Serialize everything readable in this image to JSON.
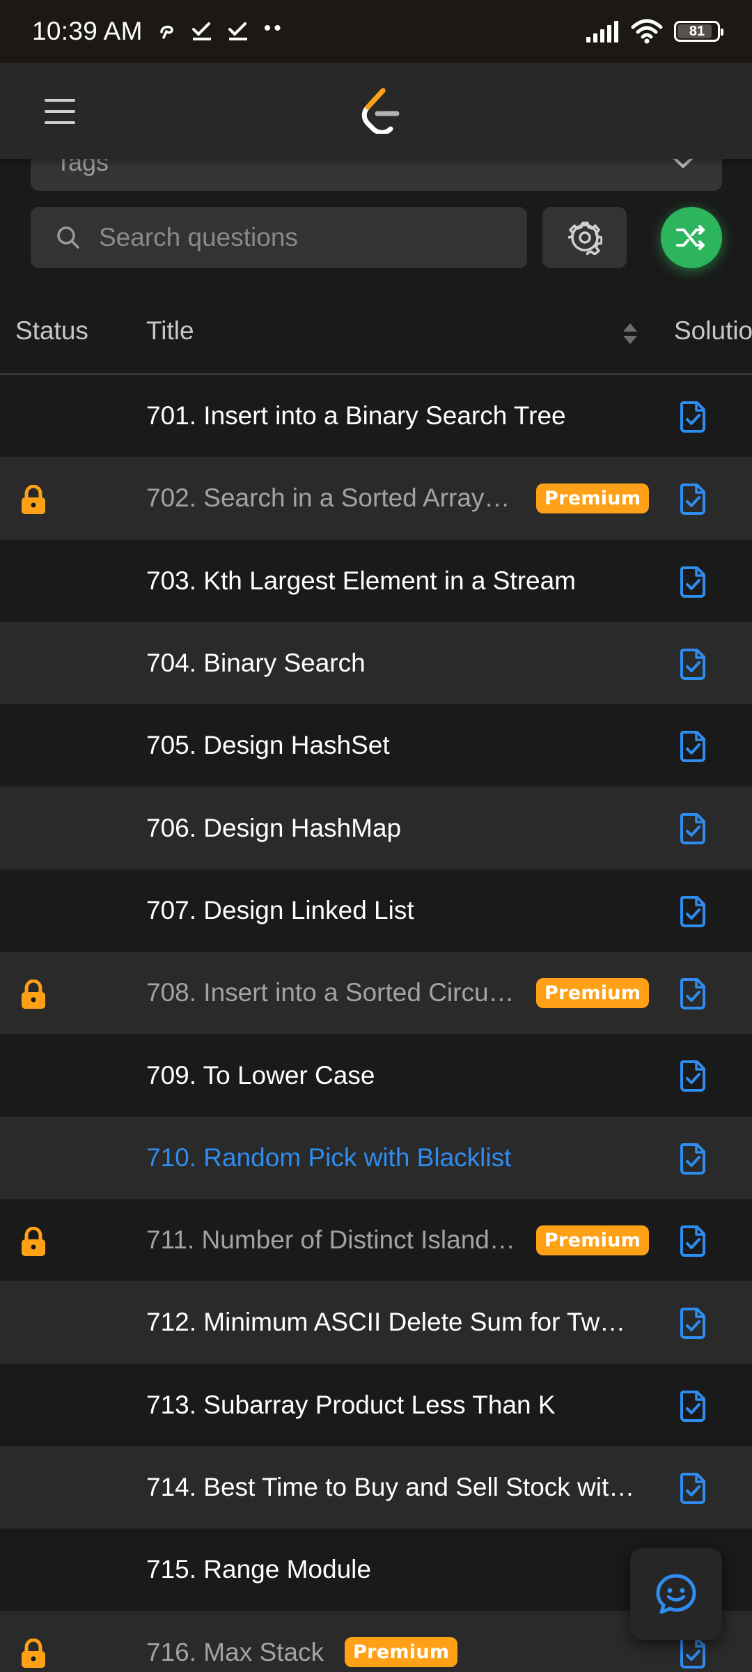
{
  "status_bar": {
    "time": "10:39 AM",
    "battery": "81",
    "icons": [
      "notification-icon",
      "check-icon",
      "check-icon",
      "more-dots-icon",
      "signal-icon",
      "wifi-icon",
      "battery-icon"
    ]
  },
  "header": {
    "menu_icon": "hamburger-menu-icon",
    "logo": "leetcode-logo"
  },
  "filters": {
    "tags_label": "Tags",
    "search_placeholder": "Search questions",
    "settings_icon": "gear-icon",
    "shuffle_icon": "shuffle-icon"
  },
  "table": {
    "columns": {
      "status": "Status",
      "title": "Title",
      "solution": "Solution"
    },
    "premium_label": "Premium",
    "rows": [
      {
        "title": "701. Insert into a Binary Search Tree",
        "locked": false,
        "premium": false,
        "style": "normal"
      },
      {
        "title": "702. Search in a Sorted Array …",
        "locked": true,
        "premium": true,
        "style": "muted"
      },
      {
        "title": "703. Kth Largest Element in a Stream",
        "locked": false,
        "premium": false,
        "style": "normal"
      },
      {
        "title": "704. Binary Search",
        "locked": false,
        "premium": false,
        "style": "normal"
      },
      {
        "title": "705. Design HashSet",
        "locked": false,
        "premium": false,
        "style": "normal"
      },
      {
        "title": "706. Design HashMap",
        "locked": false,
        "premium": false,
        "style": "normal"
      },
      {
        "title": "707. Design Linked List",
        "locked": false,
        "premium": false,
        "style": "normal"
      },
      {
        "title": "708. Insert into a Sorted Circul…",
        "locked": true,
        "premium": true,
        "style": "muted"
      },
      {
        "title": "709. To Lower Case",
        "locked": false,
        "premium": false,
        "style": "normal"
      },
      {
        "title": "710. Random Pick with Blacklist",
        "locked": false,
        "premium": false,
        "style": "link"
      },
      {
        "title": "711. Number of Distinct Island…",
        "locked": true,
        "premium": true,
        "style": "muted"
      },
      {
        "title": "712. Minimum ASCII Delete Sum for Tw…",
        "locked": false,
        "premium": false,
        "style": "normal"
      },
      {
        "title": "713. Subarray Product Less Than K",
        "locked": false,
        "premium": false,
        "style": "normal"
      },
      {
        "title": "714. Best Time to Buy and Sell Stock wit…",
        "locked": false,
        "premium": false,
        "style": "normal"
      },
      {
        "title": "715. Range Module",
        "locked": false,
        "premium": false,
        "style": "normal"
      },
      {
        "title": "716. Max Stack",
        "locked": true,
        "premium": true,
        "style": "muted"
      }
    ]
  },
  "colors": {
    "accent_green": "#2db55d",
    "premium_orange": "#ffa116",
    "link_blue": "#2f8df0",
    "lock_orange": "#ffa116"
  },
  "fab": {
    "icon": "chat-smile-icon"
  }
}
